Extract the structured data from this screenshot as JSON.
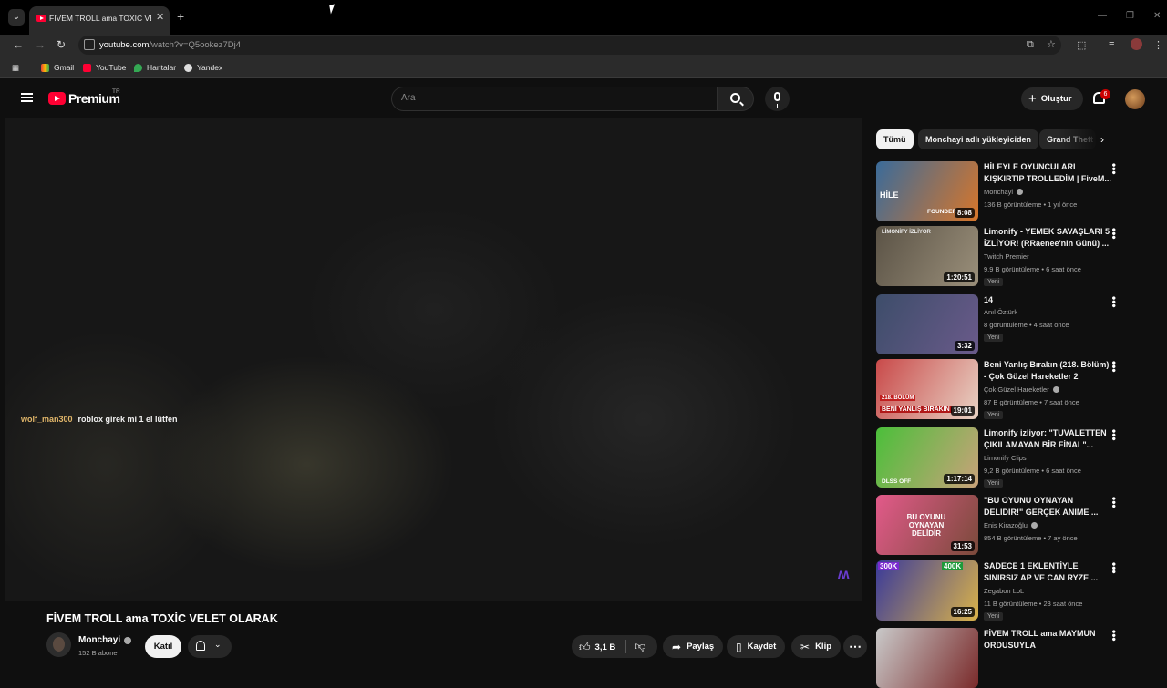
{
  "browser": {
    "tab_title": "FİVEM TROLL ama TOXİC VELET",
    "url_host": "youtube.com",
    "url_path": "/watch?v=Q5ookez7Dj4",
    "bookmarks": [
      "Gmail",
      "YouTube",
      "Haritalar",
      "Yandex"
    ]
  },
  "masthead": {
    "logo_text": "Premium",
    "country_code": "TR",
    "search_placeholder": "Ara",
    "create_label": "Oluştur",
    "notification_count": "6"
  },
  "player": {
    "chat_user": "wolf_man300",
    "chat_message": "roblox girek mi 1 el lütfen"
  },
  "video": {
    "title": "FİVEM TROLL ama TOXİC VELET OLARAK",
    "channel": "Monchayi",
    "subscribers": "152 B abone",
    "join_label": "Katıl",
    "likes": "3,1 B",
    "share_label": "Paylaş",
    "save_label": "Kaydet",
    "clip_label": "Klip"
  },
  "chips": [
    "Tümü",
    "Monchayi adlı yükleyiciden",
    "Grand Theft"
  ],
  "recommendations": [
    {
      "title": "HİLEYLE OYUNCULARI KIŞKIRTIP TROLLEDİM | FiveM...",
      "channel": "Monchayi",
      "verified": true,
      "views": "136 B görüntüleme",
      "age": "1 yıl önce",
      "duration": "8:08",
      "badge": "",
      "thumb_a": "#3a6b9a",
      "thumb_b": "#d8762a"
    },
    {
      "title": "Limonify - YEMEK SAVAŞLARI 5 İZLİYOR! (RRaenee'nin Günü) ...",
      "channel": "Twitch Premier",
      "verified": false,
      "views": "9,9 B görüntüleme",
      "age": "6 saat önce",
      "duration": "1:20:51",
      "badge": "Yeni",
      "thumb_a": "#5b5346",
      "thumb_b": "#9a8f7a"
    },
    {
      "title": "14",
      "channel": "Anıl Öztürk",
      "verified": false,
      "views": "8 görüntüleme",
      "age": "4 saat önce",
      "duration": "3:32",
      "badge": "Yeni",
      "thumb_a": "#3d4d6a",
      "thumb_b": "#6a5a8a"
    },
    {
      "title": "Beni Yanlış Bırakın (218. Bölüm) - Çok Güzel Hareketler 2",
      "channel": "Çok Güzel Hareketler",
      "verified": true,
      "views": "87 B görüntüleme",
      "age": "7 saat önce",
      "duration": "19:01",
      "badge": "Yeni",
      "thumb_a": "#c94a4a",
      "thumb_b": "#e8d2c4"
    },
    {
      "title": "Limonify izliyor: \"TUVALETTEN ÇIKILAMAYAN BİR FİNAL\"...",
      "channel": "Limonify Clips",
      "verified": false,
      "views": "9,2 B görüntüleme",
      "age": "6 saat önce",
      "duration": "1:17:14",
      "badge": "Yeni",
      "thumb_a": "#4bbf3a",
      "thumb_b": "#c9a27a"
    },
    {
      "title": "\"BU OYUNU OYNAYAN DELİDİR!\" GERÇEK ANİME ...",
      "channel": "Enis Kirazoğlu",
      "verified": true,
      "views": "854 B görüntüleme",
      "age": "7 ay önce",
      "duration": "31:53",
      "badge": "",
      "thumb_a": "#e25a8a",
      "thumb_b": "#7a4a3a"
    },
    {
      "title": "SADECE 1 EKLENTİYLE SINIRSIZ AP VE CAN RYZE ...",
      "channel": "Zegabon LoL",
      "verified": false,
      "views": "11 B görüntüleme",
      "age": "23 saat önce",
      "duration": "16:25",
      "badge": "Yeni",
      "thumb_a": "#3a3a9a",
      "thumb_b": "#d9b24a"
    },
    {
      "title": "FİVEM TROLL ama MAYMUN ORDUSUYLA",
      "channel": "",
      "verified": false,
      "views": "",
      "age": "",
      "duration": "",
      "badge": "",
      "thumb_a": "#c9c9c9",
      "thumb_b": "#7a2a2a"
    }
  ],
  "thumb_text": {
    "r1_left": "HİLE",
    "r1_right": "FOUNDER",
    "r2_top": "LİMONİFY  İZLİYOR",
    "r4_bottom": "BENİ YANLIŞ BIRAKIN",
    "r4_tag": "218. BÖLÜM",
    "r5_left": "DLSS OFF",
    "r6_center": "BU OYUNU OYNAYAN DELİDİR",
    "r7_left": "300K",
    "r7_right": "400K"
  }
}
